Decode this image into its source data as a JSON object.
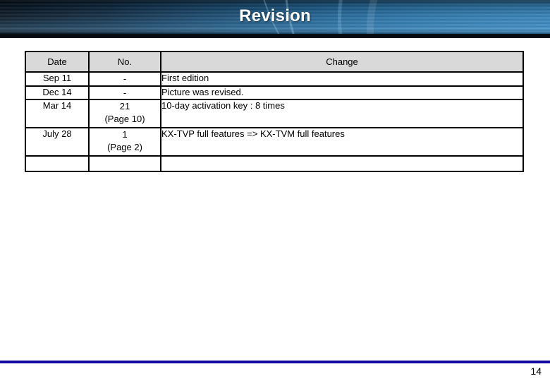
{
  "slide": {
    "title": "Revision",
    "page_number": "14",
    "accent_color": "#1209a0",
    "banner_color": "#2f80b8",
    "header_cell_color": "#d9d9d9"
  },
  "table": {
    "columns": [
      "Date",
      "No.",
      "Change"
    ],
    "rows": [
      {
        "date": "Sep 11",
        "no": "-",
        "no_sub": "",
        "change": "First edition"
      },
      {
        "date": "Dec 14",
        "no": "-",
        "no_sub": "",
        "change": "Picture was revised."
      },
      {
        "date": "Mar 14",
        "no": "21",
        "no_sub": "(Page 10)",
        "change": "10-day activation key : 8 times"
      },
      {
        "date": "July 28",
        "no": "1",
        "no_sub": "(Page 2)",
        "change": "KX-TVP full features => KX-TVM full features"
      },
      {
        "date": "",
        "no": "",
        "no_sub": "",
        "change": ""
      }
    ]
  }
}
